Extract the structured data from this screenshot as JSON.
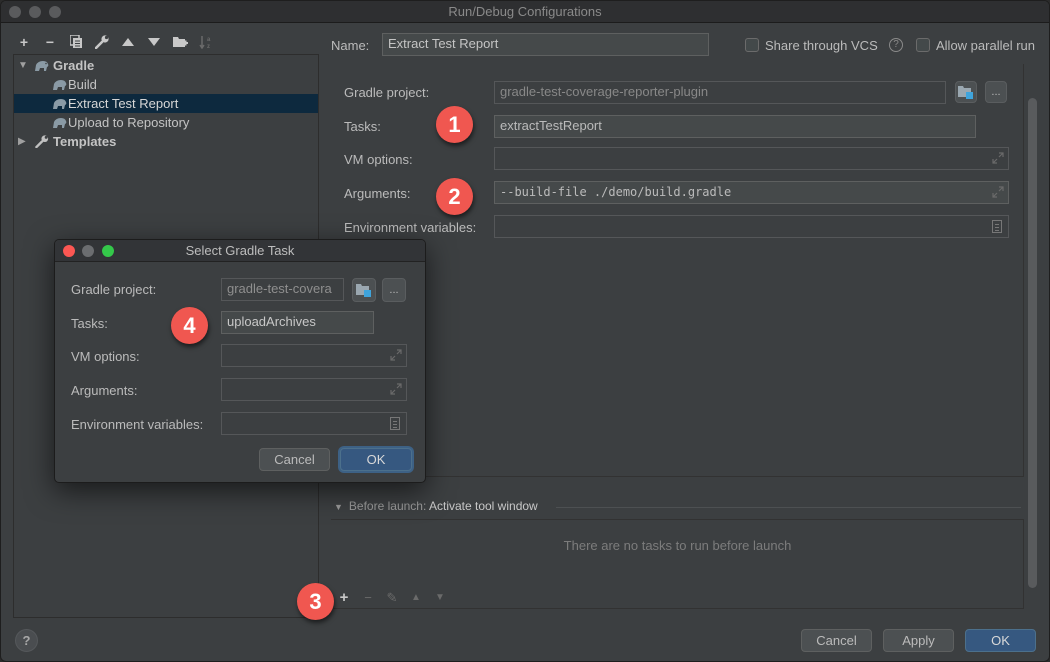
{
  "window": {
    "title": "Run/Debug Configurations"
  },
  "left_toolbar": {
    "items": [
      {
        "icon": "plus-icon",
        "glyph": "+"
      },
      {
        "icon": "minus-icon",
        "glyph": "−"
      },
      {
        "icon": "copy-icon",
        "glyph": "⧉"
      },
      {
        "icon": "wrench-icon",
        "glyph": "🔧"
      },
      {
        "icon": "arrow-up-icon",
        "glyph": "▲"
      },
      {
        "icon": "arrow-down-icon",
        "glyph": "▼"
      },
      {
        "icon": "new-folder-icon",
        "glyph": "📁"
      },
      {
        "icon": "sort-alpha-icon",
        "glyph": "↓a"
      }
    ]
  },
  "tree": {
    "gradle": {
      "label": "Gradle",
      "expanded": true
    },
    "children": [
      {
        "label": "Build",
        "selected": false
      },
      {
        "label": "Extract Test Report",
        "selected": true
      },
      {
        "label": "Upload to Repository",
        "selected": false
      }
    ],
    "templates": {
      "label": "Templates",
      "expanded": false
    }
  },
  "header": {
    "name_label": "Name:",
    "name_value": "Extract Test Report",
    "share_vcs_label": "Share through VCS",
    "share_vcs_checked": false,
    "help_glyph": "?",
    "parallel_label": "Allow parallel run",
    "parallel_checked": false
  },
  "config": {
    "gradle_project_label": "Gradle project:",
    "gradle_project_value": "gradle-test-coverage-reporter-plugin",
    "tasks_label": "Tasks:",
    "tasks_value": "extractTestReport",
    "vm_options_label": "VM options:",
    "vm_options_value": "",
    "arguments_label": "Arguments:",
    "arguments_value": "--build-file ./demo/build.gradle",
    "env_label": "Environment variables:",
    "env_value": "",
    "browse_glyph": "..."
  },
  "before_launch": {
    "prefix": "Before launch: ",
    "title": "Activate tool window",
    "empty_text": "There are no tasks to run before launch",
    "toolbar": [
      {
        "icon": "plus-icon",
        "glyph": "+",
        "enabled": true
      },
      {
        "icon": "minus-icon",
        "glyph": "−",
        "enabled": false
      },
      {
        "icon": "edit-icon",
        "glyph": "✎",
        "enabled": false
      },
      {
        "icon": "arrow-up-icon",
        "glyph": "▲",
        "enabled": false
      },
      {
        "icon": "arrow-down-icon",
        "glyph": "▼",
        "enabled": false
      }
    ]
  },
  "footer": {
    "help_glyph": "?",
    "cancel": "Cancel",
    "apply": "Apply",
    "ok": "OK"
  },
  "modal": {
    "title": "Select Gradle Task",
    "gradle_project_label": "Gradle project:",
    "gradle_project_value": "gradle-test-covera",
    "tasks_label": "Tasks:",
    "tasks_value": "uploadArchives",
    "vm_options_label": "VM options:",
    "arguments_label": "Arguments:",
    "env_label": "Environment variables:",
    "browse_glyph": "...",
    "cancel": "Cancel",
    "ok": "OK"
  },
  "badges": [
    "1",
    "2",
    "3",
    "4"
  ],
  "colors": {
    "background": "#3c3f41",
    "selection": "#0d293e",
    "primary_button": "#365880",
    "badge": "#f05750",
    "folder_accent": "#3fa4dc"
  }
}
